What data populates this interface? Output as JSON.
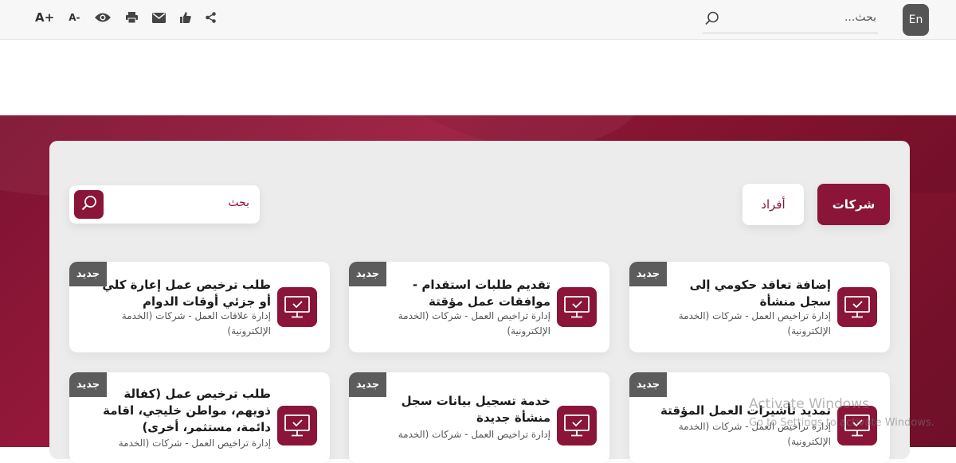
{
  "topbar": {
    "tools": {
      "increase_font": "A+",
      "decrease_font": "A-"
    },
    "search_placeholder": "بحث...",
    "language_button": "En"
  },
  "tabs": {
    "companies": "شركات",
    "individuals": "أفراد"
  },
  "content_search": {
    "placeholder": "بحث"
  },
  "colors": {
    "brand": "#8a1538",
    "badge": "#5c5c5c",
    "panel": "#ececec"
  },
  "cards": [
    {
      "badge": "جديد",
      "title": "إضافة تعاقد حكومي إلى سجل منشأة",
      "subtitle": "إدارة تراخيص العمل - شركات (الخدمة الإلكترونية)",
      "icon": "monitor-check-icon"
    },
    {
      "badge": "جديد",
      "title": "تقديم طلبات استقدام - موافقات عمل مؤقتة",
      "subtitle": "إدارة تراخيص العمل - شركات (الخدمة الإلكترونية)",
      "icon": "monitor-check-icon"
    },
    {
      "badge": "جديد",
      "title": "طلب ترخيص عمل إعارة كلي أو جزئي أوقات الدوام",
      "subtitle": "إدارة علاقات العمل - شركات (الخدمة الإلكترونية)",
      "icon": "monitor-check-icon"
    },
    {
      "badge": "جديد",
      "title": "تمديد تأشيرات العمل المؤقتة",
      "subtitle": "إدارة تراخيص العمل - شركات (الخدمة الإلكترونية)",
      "icon": "monitor-check-icon"
    },
    {
      "badge": "جديد",
      "title": "خدمة تسجيل بيانات سجل منشأة جديدة",
      "subtitle": "إدارة تراخيص العمل - شركات (الخدمة",
      "icon": "monitor-check-icon"
    },
    {
      "badge": "جديد",
      "title": "طلب ترخيص عمل (كفالة ذويهم، مواطن خليجي، اقامة دائمة، مستثمر، أخرى)",
      "subtitle": "إدارة تراخيص العمل - شركات (الخدمة",
      "icon": "monitor-check-icon"
    }
  ],
  "os_watermark": {
    "line1": "Activate Windows",
    "line2": "Go to Settings to activate Windows."
  }
}
